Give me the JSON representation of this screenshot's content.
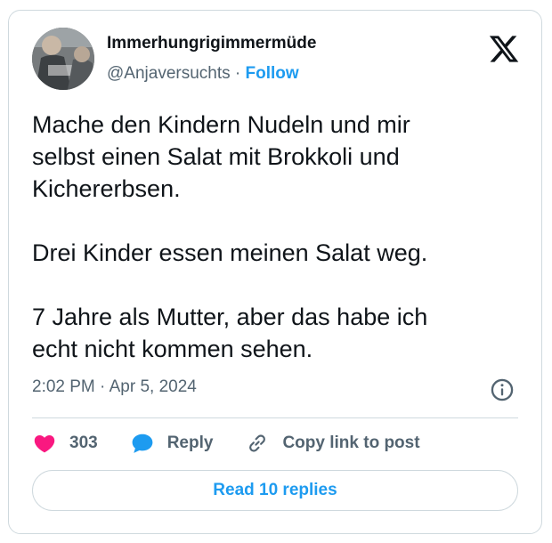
{
  "tweet": {
    "display_name": "Immerhungrigimmermüde",
    "handle": "@Anjaversuchts",
    "separator": "·",
    "follow_label": "Follow",
    "paragraphs": [
      "Mache den Kindern Nudeln und mir\nselbst einen Salat mit Brokkoli und\nKichererbsen.",
      "Drei Kinder essen meinen Salat weg.",
      "7 Jahre als Mutter, aber das habe ich\necht nicht kommen sehen."
    ],
    "time": "2:02 PM",
    "date": "Apr 5, 2024",
    "like_count": "303",
    "reply_label": "Reply",
    "copy_link_label": "Copy link to post",
    "read_replies_label": "Read 10 replies"
  },
  "icons": {
    "logo": "x-logo-icon",
    "info": "info-icon",
    "like": "heart-icon",
    "reply": "speech-bubble-icon",
    "copy": "link-icon"
  },
  "colors": {
    "accent": "#1d9bf0",
    "heart": "#f91880",
    "text": "#0f1419",
    "muted": "#536471",
    "border": "#cfd9de"
  }
}
